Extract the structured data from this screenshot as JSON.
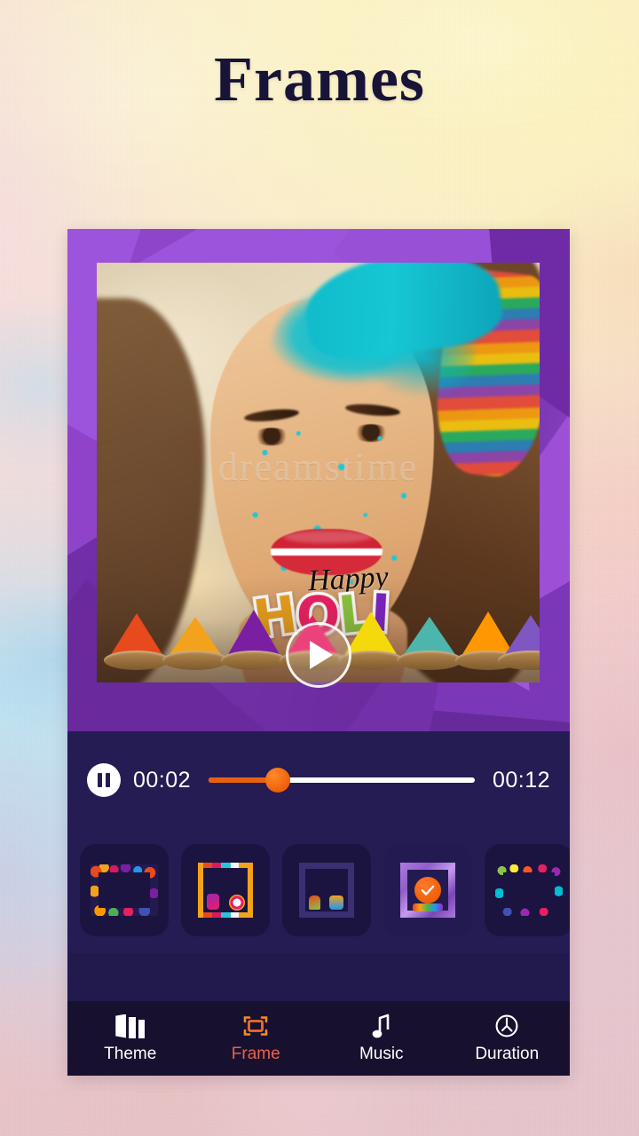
{
  "page": {
    "title": "Frames"
  },
  "preview": {
    "frame_style_name": "purple-low-poly-frame",
    "play_button_label": "play-button",
    "sticker": {
      "script_text": "Happy",
      "block_letters": [
        "H",
        "O",
        "L",
        "I"
      ]
    },
    "photo_watermark": "dreamstime"
  },
  "playback": {
    "pause_label": "pause-button",
    "current_time": "00:02",
    "total_time": "00:12",
    "progress_percent": 26,
    "accent_color": "#ef5f08",
    "track_color": "#ffffff"
  },
  "frames_strip": {
    "items": [
      {
        "id": "frame-1",
        "name": "splash-border-frame",
        "selected": false
      },
      {
        "id": "frame-2",
        "name": "rangoli-border-frame",
        "selected": false
      },
      {
        "id": "frame-3",
        "name": "kids-playing-frame",
        "selected": false
      },
      {
        "id": "frame-4",
        "name": "purple-holi-frame",
        "selected": true
      },
      {
        "id": "frame-5",
        "name": "neon-splash-frame",
        "selected": false
      }
    ],
    "selected_badge": "check-icon"
  },
  "bottom_nav": {
    "items": [
      {
        "label": "Theme",
        "icon": "panels-icon",
        "active": false
      },
      {
        "label": "Frame",
        "icon": "frame-icon",
        "active": true
      },
      {
        "label": "Music",
        "icon": "music-note-icon",
        "active": false
      },
      {
        "label": "Duration",
        "icon": "clock-icon",
        "active": false
      }
    ],
    "active_color": "#ef5f4a",
    "inactive_color": "#ffffff"
  },
  "colors": {
    "panel_bg": "#241c52",
    "nav_bg": "#17112f",
    "title_color": "#171437",
    "frame_purple": "#8e43c9"
  }
}
